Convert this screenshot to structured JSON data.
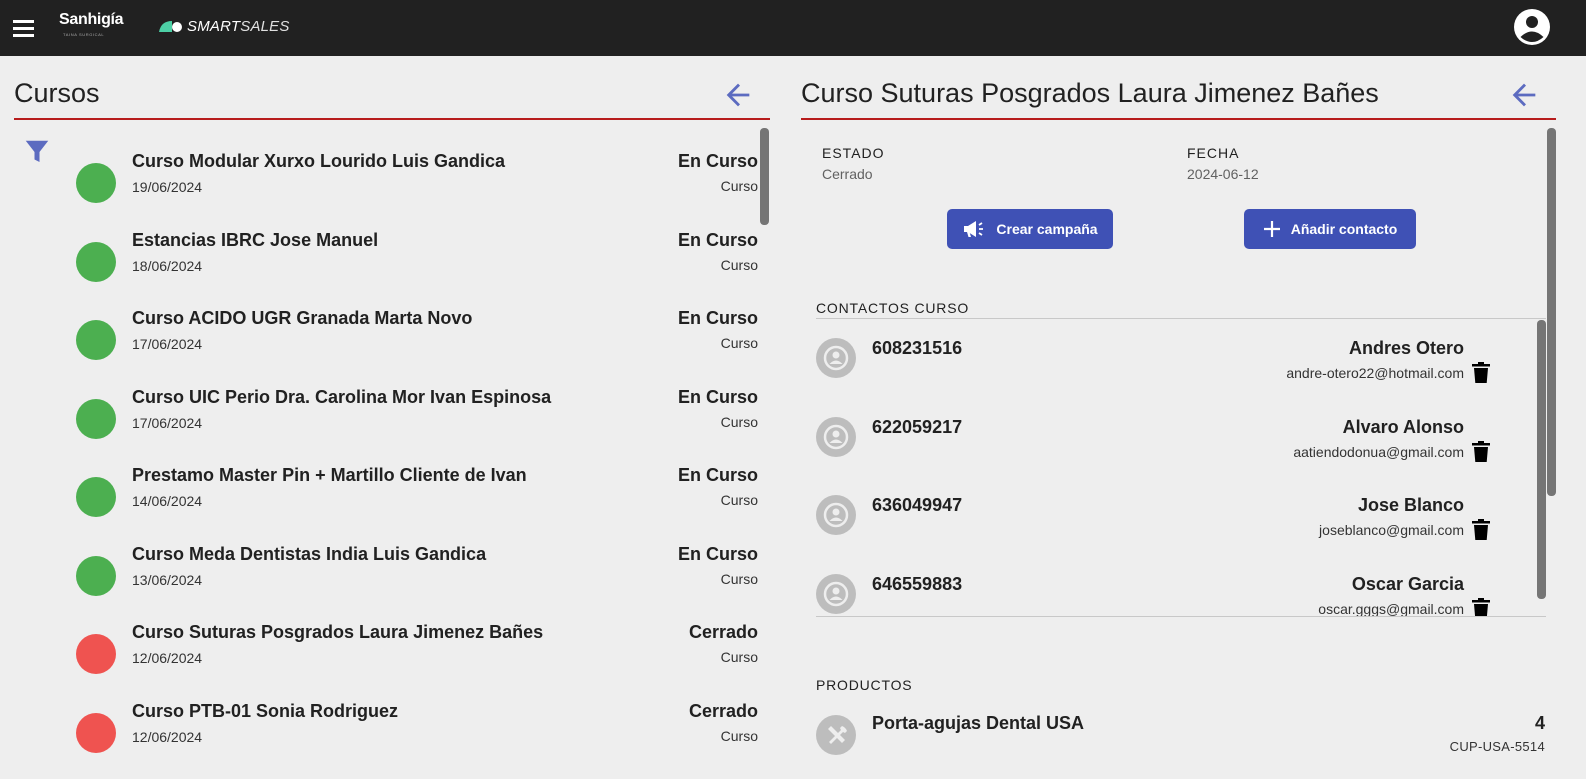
{
  "header": {
    "brand_primary": "Sanhigía",
    "brand_primary_tagline": "TAINA SURGICAL",
    "brand_secondary_bold": "SMART",
    "brand_secondary_light": "SALES"
  },
  "left_panel": {
    "title": "Cursos",
    "courses": [
      {
        "name": "Curso Modular Xurxo Lourido Luis Gandica",
        "date": "19/06/2024",
        "status": "En Curso",
        "type": "Curso",
        "color": "#4caf50"
      },
      {
        "name": "Estancias IBRC Jose Manuel",
        "date": "18/06/2024",
        "status": "En Curso",
        "type": "Curso",
        "color": "#4caf50"
      },
      {
        "name": "Curso ACIDO UGR Granada Marta Novo",
        "date": "17/06/2024",
        "status": "En Curso",
        "type": "Curso",
        "color": "#4caf50"
      },
      {
        "name": "Curso UIC Perio Dra. Carolina Mor Ivan Espinosa",
        "date": "17/06/2024",
        "status": "En Curso",
        "type": "Curso",
        "color": "#4caf50"
      },
      {
        "name": "Prestamo Master Pin + Martillo Cliente de Ivan",
        "date": "14/06/2024",
        "status": "En Curso",
        "type": "Curso",
        "color": "#4caf50"
      },
      {
        "name": "Curso Meda Dentistas India Luis Gandica",
        "date": "13/06/2024",
        "status": "En Curso",
        "type": "Curso",
        "color": "#4caf50"
      },
      {
        "name": "Curso Suturas Posgrados Laura Jimenez Bañes",
        "date": "12/06/2024",
        "status": "Cerrado",
        "type": "Curso",
        "color": "#ef5350"
      },
      {
        "name": "Curso PTB-01 Sonia Rodriguez",
        "date": "12/06/2024",
        "status": "Cerrado",
        "type": "Curso",
        "color": "#ef5350"
      }
    ]
  },
  "right_panel": {
    "title": "Curso Suturas Posgrados Laura Jimenez Bañes",
    "estado_label": "ESTADO",
    "estado_value": "Cerrado",
    "fecha_label": "FECHA",
    "fecha_value": "2024-06-12",
    "create_campaign_label": "Crear campaña",
    "add_contact_label": "Añadir contacto",
    "contacts_section_label": "CONTACTOS CURSO",
    "contacts": [
      {
        "phone": "608231516",
        "name": "Andres Otero",
        "email": "andre-otero22@hotmail.com"
      },
      {
        "phone": "622059217",
        "name": "Alvaro Alonso",
        "email": "aatiendodonua@gmail.com"
      },
      {
        "phone": "636049947",
        "name": "Jose Blanco",
        "email": "joseblanco@gmail.com"
      },
      {
        "phone": "646559883",
        "name": "Oscar Garcia",
        "email": "oscar.gggs@gmail.com"
      }
    ],
    "products_section_label": "PRODUCTOS",
    "products": [
      {
        "name": "Porta-agujas Dental USA",
        "qty": "4",
        "code": "CUP-USA-5514"
      }
    ]
  },
  "colors": {
    "accent": "#5c6bc0",
    "primary_button": "#3f51b5",
    "title_underline": "#b71c1c",
    "topbar": "#212121",
    "status_open": "#4caf50",
    "status_closed": "#ef5350"
  }
}
